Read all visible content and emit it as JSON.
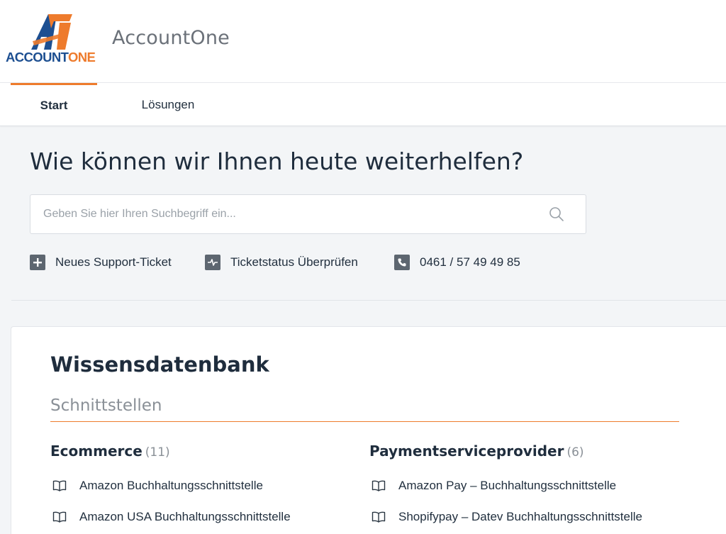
{
  "header": {
    "logo_text": "ACCOUNTONE",
    "logo_mark": "A",
    "brand_name": "AccountOne"
  },
  "nav": {
    "tabs": [
      {
        "label": "Start",
        "active": true
      },
      {
        "label": "Lösungen",
        "active": false
      }
    ]
  },
  "hero": {
    "title": "Wie können wir Ihnen heute weiterhelfen?",
    "search": {
      "placeholder": "Geben Sie hier Ihren Suchbegriff ein...",
      "value": "",
      "icon": "search-icon"
    },
    "quick_links": [
      {
        "label": "Neues Support-Ticket",
        "icon": "plus-icon"
      },
      {
        "label": "Ticketstatus Überprüfen",
        "icon": "activity-icon"
      },
      {
        "label": "0461 / 57 49 49 85",
        "icon": "phone-icon"
      }
    ]
  },
  "knowledge_base": {
    "title": "Wissensdatenbank",
    "section": "Schnittstellen",
    "categories": [
      {
        "title": "Ecommerce",
        "count": "(11)",
        "articles": [
          "Amazon Buchhaltungsschnittstelle",
          "Amazon USA Buchhaltungsschnittstelle"
        ]
      },
      {
        "title": "Paymentserviceprovider",
        "count": "(6)",
        "articles": [
          "Amazon Pay – Buchhaltungsschnittstelle",
          "Shopifypay – Datev Buchhaltungsschnittstelle"
        ]
      }
    ]
  },
  "colors": {
    "accent": "#ee7b2c",
    "logo_blue": "#1d4f91",
    "icon_gray": "#5d6670",
    "text_dark": "#1f2d3d",
    "page_bg": "#f3f5f7"
  }
}
